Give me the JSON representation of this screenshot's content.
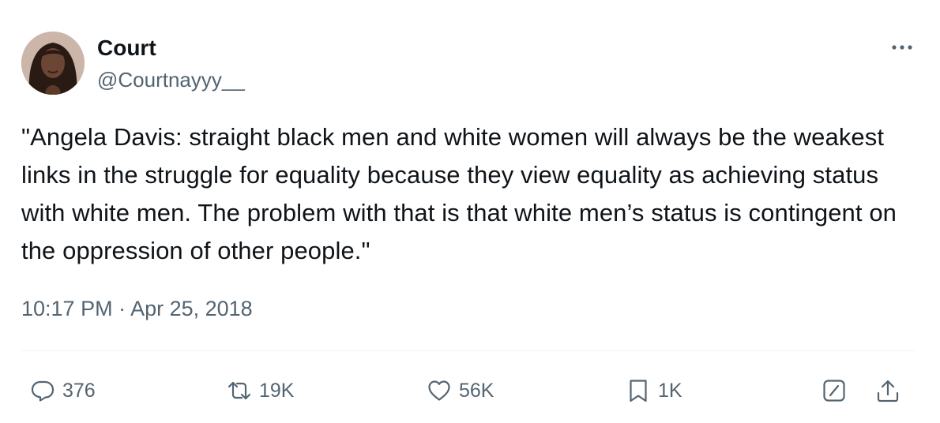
{
  "author": {
    "name": "Court",
    "handle": "@Courtnayyy__"
  },
  "tweet": {
    "text": "\"Angela Davis: straight black men and white women will always be the weakest links in the struggle for equality because they view equality as achieving status with white men. The problem with that is that white men’s status is contingent on the oppression of other people.\"",
    "timestamp": "10:17 PM · Apr 25, 2018"
  },
  "actions": {
    "replies": "376",
    "retweets": "19K",
    "likes": "56K",
    "bookmarks": "1K"
  },
  "icons": [
    "more-icon",
    "reply-icon",
    "retweet-icon",
    "like-icon",
    "bookmark-icon",
    "grok-icon",
    "share-icon"
  ],
  "colors": {
    "text": "#0f1419",
    "secondary": "#536471",
    "divider": "#eff3f4"
  }
}
